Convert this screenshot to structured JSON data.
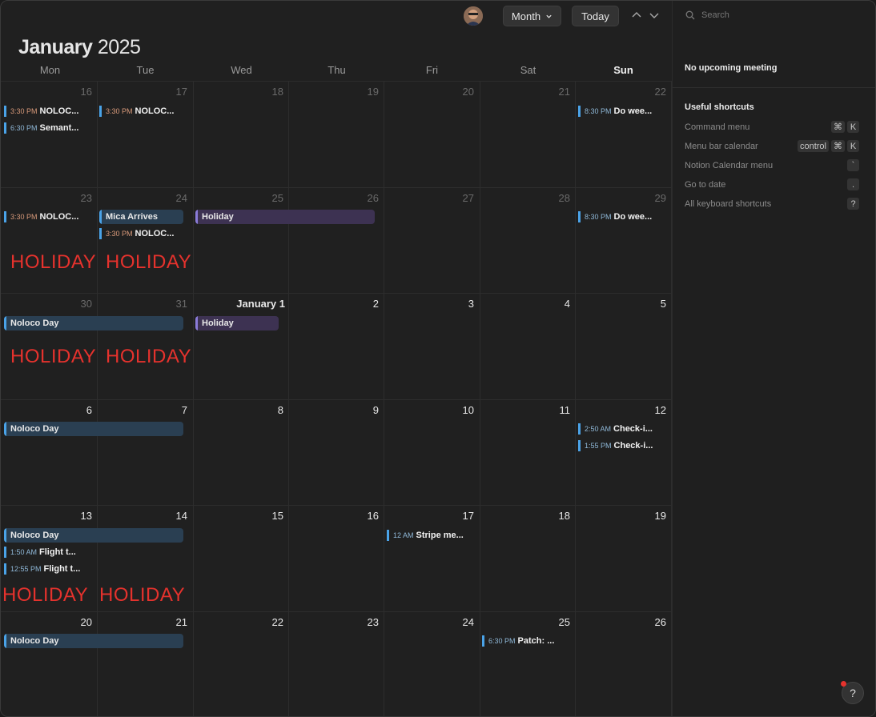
{
  "header": {
    "view_select": "Month",
    "today_label": "Today",
    "title_month": "January",
    "title_year": "2025"
  },
  "days_of_week": [
    "Mon",
    "Tue",
    "Wed",
    "Thu",
    "Fri",
    "Sat",
    "Sun"
  ],
  "weeks": [
    {
      "days": [
        "16",
        "17",
        "18",
        "19",
        "20",
        "21",
        "22"
      ]
    },
    {
      "days": [
        "23",
        "24",
        "25",
        "26",
        "27",
        "28",
        "29"
      ]
    },
    {
      "days": [
        "30",
        "31",
        "January 1",
        "2",
        "3",
        "4",
        "5"
      ]
    },
    {
      "days": [
        "6",
        "7",
        "8",
        "9",
        "10",
        "11",
        "12"
      ]
    },
    {
      "days": [
        "13",
        "14",
        "15",
        "16",
        "17",
        "18",
        "19"
      ]
    },
    {
      "days": [
        "20",
        "21",
        "22",
        "23",
        "24",
        "25",
        "26"
      ]
    }
  ],
  "events": {
    "w0_mon_1": {
      "time": "3:30 PM",
      "name": "NOLOC..."
    },
    "w0_mon_2": {
      "time": "6:30 PM",
      "name": "Semant..."
    },
    "w0_tue_1": {
      "time": "3:30 PM",
      "name": "NOLOC..."
    },
    "w0_sun_1": {
      "time": "8:30 PM",
      "name": "Do wee..."
    },
    "w1_mon_1": {
      "time": "3:30 PM",
      "name": "NOLOC..."
    },
    "w1_tue_allday": "Mica Arrives",
    "w1_tue_1": {
      "time": "3:30 PM",
      "name": "NOLOC..."
    },
    "w1_wed_allday": "Holiday",
    "w1_sun_1": {
      "time": "8:30 PM",
      "name": "Do wee..."
    },
    "w2_mon_allday": "Noloco Day",
    "w2_wed_allday": "Holiday",
    "w3_mon_allday": "Noloco Day",
    "w3_sun_1": {
      "time": "2:50 AM",
      "name": "Check-i..."
    },
    "w3_sun_2": {
      "time": "1:55 PM",
      "name": "Check-i..."
    },
    "w4_mon_allday": "Noloco Day",
    "w4_mon_1": {
      "time": "1:50 AM",
      "name": "Flight t..."
    },
    "w4_mon_2": {
      "time": "12:55 PM",
      "name": "Flight t..."
    },
    "w4_fri_1": {
      "time": "12 AM",
      "name": "Stripe me..."
    },
    "w5_mon_allday": "Noloco Day",
    "w5_sat_1": {
      "time": "6:30 PM",
      "name": "Patch: ..."
    }
  },
  "holiday_label": "HOLIDAY",
  "sidebar": {
    "search_placeholder": "Search",
    "upcoming": "No upcoming meeting",
    "shortcuts_title": "Useful shortcuts",
    "shortcuts": [
      {
        "label": "Command menu",
        "keys": [
          "⌘",
          "K"
        ]
      },
      {
        "label": "Menu bar calendar",
        "keys": [
          "control",
          "⌘",
          "K"
        ]
      },
      {
        "label": "Notion Calendar menu",
        "keys": [
          "`"
        ]
      },
      {
        "label": "Go to date",
        "keys": [
          "."
        ]
      },
      {
        "label": "All keyboard shortcuts",
        "keys": [
          "?"
        ]
      }
    ],
    "help_label": "?"
  },
  "colors": {
    "accent_blue": "#4aa3e8",
    "holiday_red": "#e5322d",
    "allday_blue": "#2a3f52",
    "allday_purple": "#3d3252"
  }
}
